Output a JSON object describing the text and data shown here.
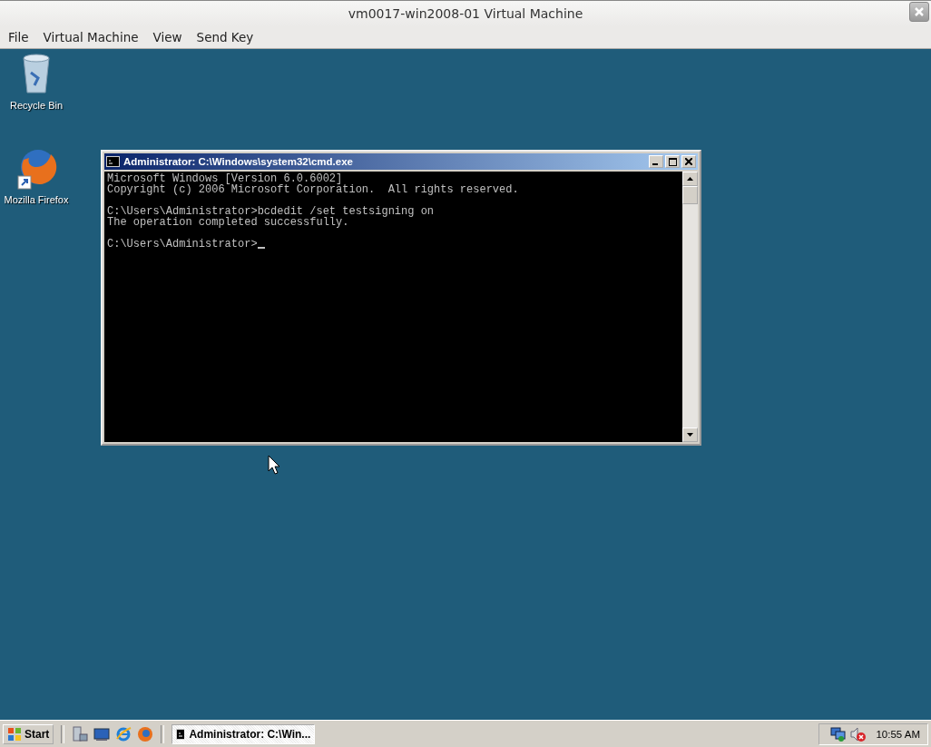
{
  "window": {
    "title": "vm0017-win2008-01 Virtual Machine"
  },
  "menu": [
    "File",
    "Virtual Machine",
    "View",
    "Send Key"
  ],
  "desktop_icons": [
    {
      "kind": "recycle",
      "label": "Recycle Bin"
    },
    {
      "kind": "firefox",
      "label": "Mozilla Firefox"
    }
  ],
  "console": {
    "title": "Administrator: C:\\Windows\\system32\\cmd.exe",
    "blocks": [
      [
        "Microsoft Windows [Version 6.0.6002]",
        "Copyright (c) 2006 Microsoft Corporation.  All rights reserved."
      ],
      [
        "C:\\Users\\Administrator>bcdedit /set testsigning on",
        "The operation completed successfully."
      ],
      [
        "C:\\Users\\Administrator>"
      ]
    ]
  },
  "taskbar": {
    "start": "Start",
    "quick_launch": [
      {
        "kind": "server"
      },
      {
        "kind": "desktop"
      },
      {
        "kind": "ie"
      },
      {
        "kind": "firefox"
      }
    ],
    "tasks": [
      {
        "label": "Administrator: C:\\Win...",
        "selected": true
      }
    ],
    "clock": "10:55 AM"
  }
}
